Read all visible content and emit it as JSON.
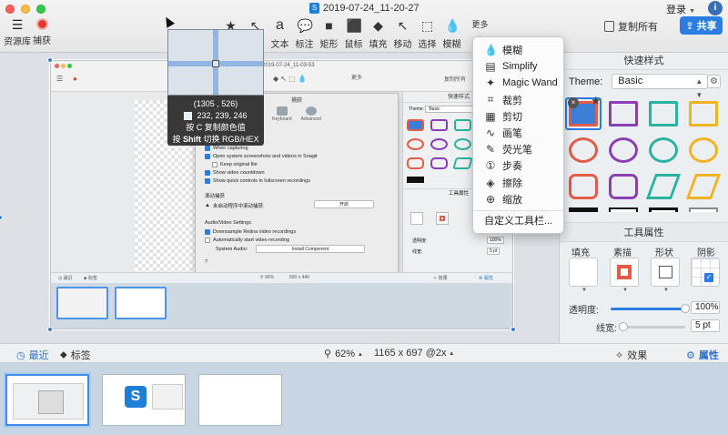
{
  "window": {
    "title": "2019-07-24_11-20-27",
    "login_label": "登录",
    "info_icon": "info-icon"
  },
  "toolbar": {
    "library_label": "资源库",
    "capture_label": "捕获",
    "tools": [
      {
        "name": "favorites",
        "label": "",
        "icon": "★"
      },
      {
        "name": "arrow",
        "label": "",
        "icon": "↖"
      },
      {
        "name": "text",
        "label": "文本",
        "icon": "a"
      },
      {
        "name": "callout",
        "label": "标注",
        "icon": "💬"
      },
      {
        "name": "shape",
        "label": "矩形",
        "icon": "■"
      },
      {
        "name": "stamp",
        "label": "鼠标",
        "icon": "⬛"
      },
      {
        "name": "fill",
        "label": "填充",
        "icon": "◆"
      },
      {
        "name": "move",
        "label": "移动",
        "icon": "↖"
      },
      {
        "name": "select",
        "label": "选择",
        "icon": "⬚"
      },
      {
        "name": "blur",
        "label": "模糊",
        "icon": "💧"
      }
    ],
    "more_label": "更多",
    "copy_all_label": "复制所有",
    "share_label": "共享"
  },
  "magnifier": {
    "coords": "(1305 , 526)",
    "rgb": "232, 239, 246",
    "hint_copy": "按 C 复制颜色值",
    "hint_copy_key": "C",
    "hint_switch_prefix": "按 ",
    "hint_switch_key": "Shift",
    "hint_switch_suffix": " 切换 RGB/HEX",
    "swatch_color": "#e8eff6"
  },
  "more_menu": {
    "items": [
      {
        "label": "模糊",
        "icon": "💧"
      },
      {
        "label": "Simplify",
        "icon": "▤"
      },
      {
        "label": "Magic Wand",
        "icon": "✦"
      },
      {
        "label": "裁剪",
        "icon": "⌗"
      },
      {
        "label": "剪切",
        "icon": "▦"
      },
      {
        "label": "画笔",
        "icon": "∿"
      },
      {
        "label": "荧光笔",
        "icon": "✎"
      },
      {
        "label": "步奏",
        "icon": "①"
      },
      {
        "label": "擦除",
        "icon": "◈"
      },
      {
        "label": "缩放",
        "icon": "⊕"
      }
    ],
    "customize_label": "自定义工具栏..."
  },
  "quick_styles": {
    "header": "快速样式",
    "theme_label": "Theme:",
    "theme_value": "Basic"
  },
  "tool_props": {
    "header": "工具属性",
    "col_fill": "填充",
    "col_outline": "素描",
    "col_shape": "形状",
    "col_shadow": "阴影",
    "opacity_label": "透明度:",
    "opacity_value": "100%",
    "opacity_level": 1.0,
    "width_label": "线宽:",
    "width_value": "5 pt",
    "width_level": 0.05
  },
  "bottom_bar": {
    "recent_label": "最近",
    "tags_label": "标签",
    "zoom_label": "62%",
    "dimensions_label": "1165 x 697 @2x",
    "effects_label": "效果",
    "properties_label": "属性"
  },
  "inner_screenshot": {
    "title": "2019-07-24_11-03-53",
    "dialog_title": "捕获",
    "tab_keyboard": "Keyboard",
    "tab_advanced": "Advanced",
    "opt_1": "When capturing",
    "opt_2": "Open system screenshots and videos in Snagit",
    "opt_3": "Keep original file",
    "opt_4": "Show video countdown",
    "opt_5": "Show quick controls in fullscreen recordings",
    "section_scroll": "滚动捕获",
    "scroll_text": "未启动程序中滚动捕获.",
    "scroll_button": "开启",
    "section_av": "Audio/Video Settings",
    "av_1": "Downsample Retina video recordings",
    "av_2": "Automatically start video recording",
    "system_audio_label": "System Audio:",
    "install_button": "Install Component",
    "help": "?",
    "zoom": "96%",
    "size": "500 x 440",
    "recent": "最近",
    "tags": "标签",
    "effects": "效果",
    "props": "属性",
    "quick_styles": "快速样式",
    "theme_label": "Theme:",
    "theme_value": "Basic",
    "tool_props": "工具属性",
    "opacity_label": "透明度:",
    "opacity_value": "100%",
    "width_label": "线宽:",
    "width_value": "5 pt",
    "more": "更多",
    "copy_all": "复制所有"
  }
}
